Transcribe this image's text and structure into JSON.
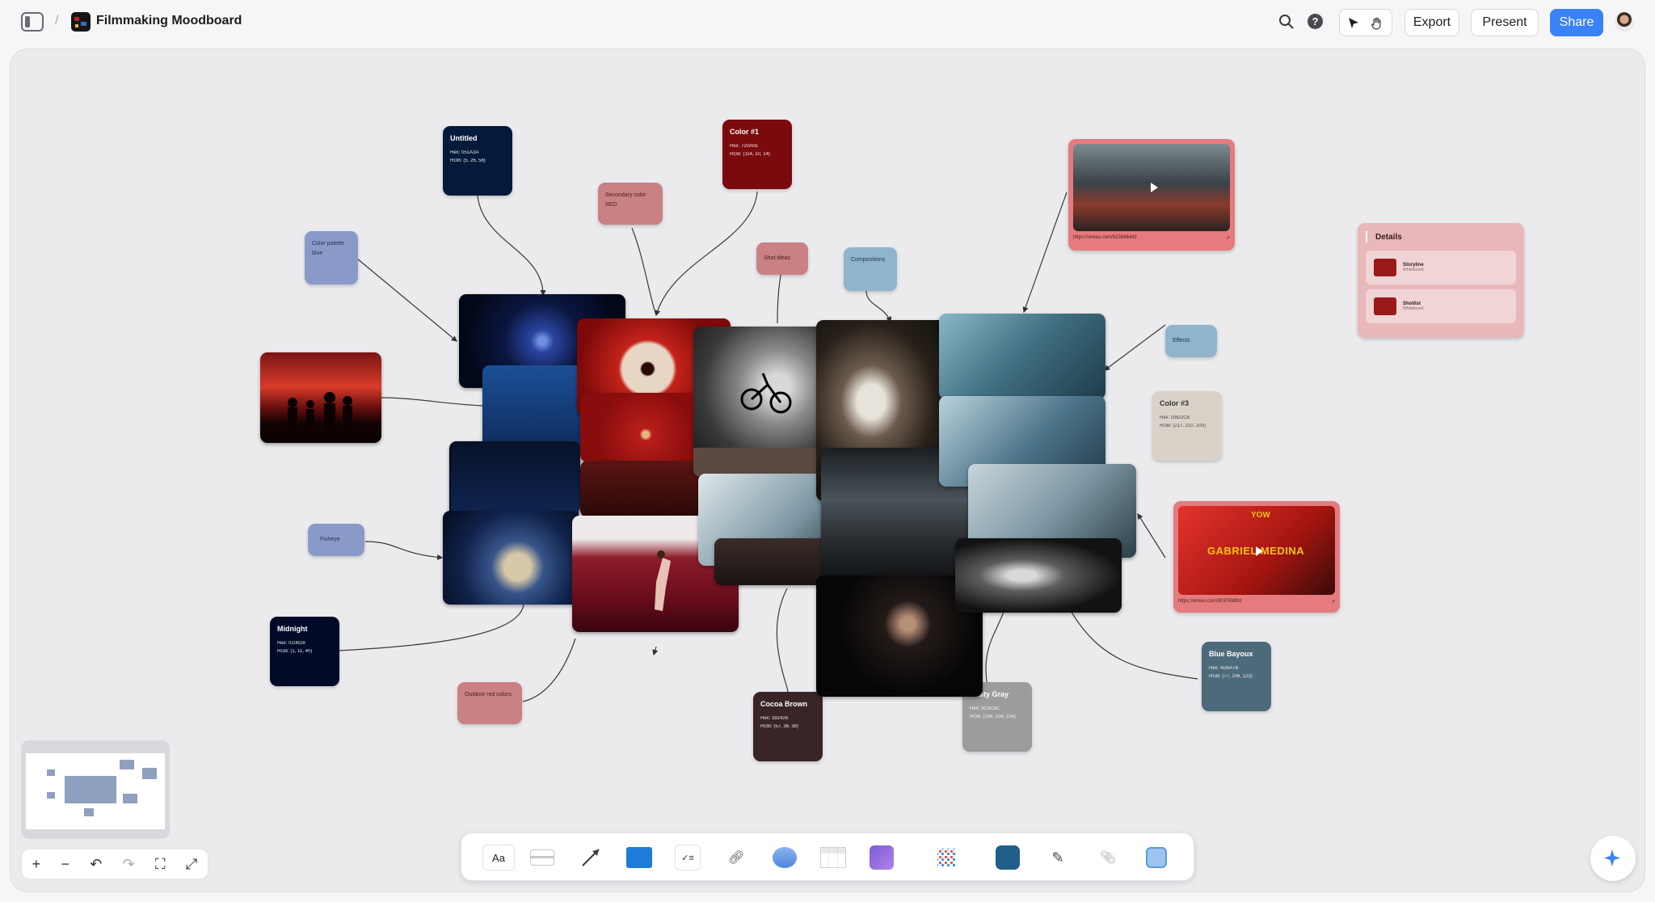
{
  "app": {
    "title": "Filmmaking Moodboard",
    "breadcrumb_sep": "/",
    "buttons": {
      "export": "Export",
      "present": "Present",
      "share": "Share"
    },
    "colors": {
      "accent": "#3a82f7"
    }
  },
  "swatches": [
    {
      "id": "untitled",
      "title": "Untitled",
      "hex": "Hex: 051A3A",
      "rgb": "RGB: (5, 26, 58)",
      "color": "#051a3a"
    },
    {
      "id": "color1",
      "title": "Color #1",
      "hex": "Hex: 720A0E",
      "rgb": "RGB: (114, 10, 14)",
      "color": "#7a0a0e"
    },
    {
      "id": "color3",
      "title": "Color #3",
      "hex": "Hex: D9D2C8",
      "rgb": "RGB: (217, 210, 200)",
      "color": "#d9d2c8"
    },
    {
      "id": "midnight",
      "title": "Midnight",
      "hex": "Hex: 010B28",
      "rgb": "RGB: (1, 11, 40)",
      "color": "#010b28"
    },
    {
      "id": "cocoa",
      "title": "Cocoa Brown",
      "hex": "Hex: 392426",
      "rgb": "RGB: (57, 36, 38)",
      "color": "#392426"
    },
    {
      "id": "dusty",
      "title": "Dusty Gray",
      "hex": "Hex: 9C9C9C",
      "rgb": "RGB: (156, 156, 156)",
      "color": "#9c9c9c"
    },
    {
      "id": "bayoux",
      "title": "Blue Bayoux",
      "hex": "Hex: 4D6A7B",
      "rgb": "RGB: (77, 106, 123)",
      "color": "#4d6a7b"
    }
  ],
  "labels": [
    {
      "id": "palette",
      "text": "Color palette blue",
      "color": "#8a9ac8"
    },
    {
      "id": "secondary",
      "text": "Secondary color RED",
      "color": "#c98184"
    },
    {
      "id": "shot",
      "text": "Shot ideas",
      "color": "#c98184"
    },
    {
      "id": "composition",
      "text": "Compositions",
      "color": "#8fb4cc"
    },
    {
      "id": "effects",
      "text": "Effects",
      "color": "#8fb4cc"
    },
    {
      "id": "fisheye",
      "text": "Fisheye",
      "color": "#8a9ac8"
    },
    {
      "id": "outdoor",
      "text": "Outdoor red colors",
      "color": "#c98184"
    }
  ],
  "videos": [
    {
      "id": "vid1",
      "url": "https://vimeo.com/923848443"
    },
    {
      "id": "vid2",
      "url": "https://vimeo.com/903769892",
      "title": "GABRIEL MEDINA",
      "top_text": "YOW"
    }
  ],
  "details": {
    "title": "Details",
    "items": [
      {
        "name": "Storyline",
        "type": "Whiteboard"
      },
      {
        "name": "Shotlist",
        "type": "Whiteboard"
      }
    ]
  },
  "toolbar": {
    "text_tool": "Aa",
    "tools": [
      "text-tool",
      "sticky-note-tool",
      "arrow-tool",
      "folder-tool",
      "checklist-tool",
      "link-tool",
      "shape-tool",
      "table-tool",
      "image-tool",
      "apps-tool",
      "app-tool",
      "draw-tool",
      "attach-tool",
      "scan-tool"
    ]
  }
}
